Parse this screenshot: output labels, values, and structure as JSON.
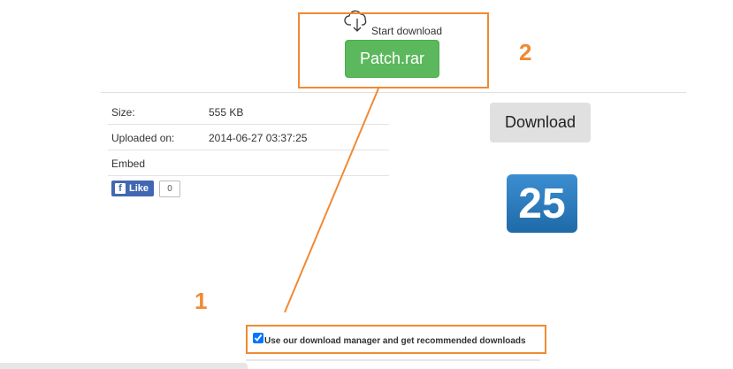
{
  "download": {
    "start_label": "Start download",
    "file_button_label": "Patch.rar",
    "icon": "cloud-download-icon"
  },
  "info": {
    "rows": [
      {
        "label": "Size:",
        "value": "555 KB"
      },
      {
        "label": "Uploaded on:",
        "value": "2014-06-27 03:37:25"
      },
      {
        "label": "Embed",
        "value": ""
      }
    ]
  },
  "social": {
    "like_label": "Like",
    "like_count": "0",
    "icon": "facebook-icon"
  },
  "side": {
    "download_button_label": "Download",
    "calendar_number": "25"
  },
  "annotations": {
    "label_1": "1",
    "label_2": "2",
    "color": "#f08a33"
  },
  "manager": {
    "checkbox_label": "Use our download manager and get recommended downloads",
    "checked": true
  },
  "colors": {
    "green_button": "#5cb85c",
    "facebook_blue": "#4267b2",
    "calendar_blue": "#2a7bc0"
  }
}
